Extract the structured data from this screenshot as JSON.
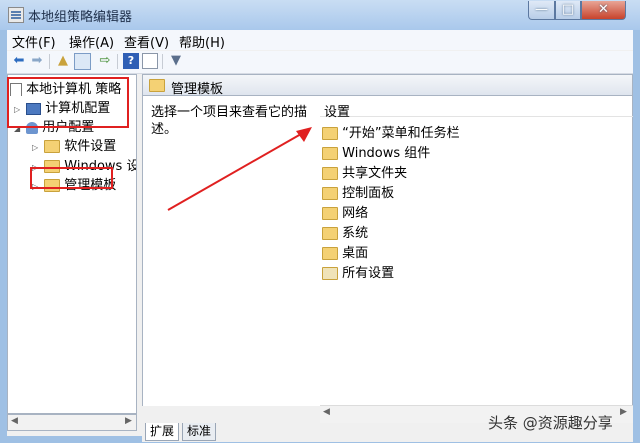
{
  "window": {
    "title": "本地组策略编辑器",
    "controls": {
      "minimize": "—",
      "maximize": "□",
      "close": "✕"
    }
  },
  "menubar": [
    "文件(F)",
    "操作(A)",
    "查看(V)",
    "帮助(H)"
  ],
  "toolbar": {
    "icons": [
      "back-arrow-icon",
      "forward-arrow-icon",
      "up-folder-icon",
      "show-hide-tree-icon",
      "export-icon",
      "help-icon",
      "properties-icon",
      "filter-icon"
    ]
  },
  "tree": {
    "root": "本地计算机 策略",
    "computer_config": "计算机配置",
    "user_config": "用户配置",
    "software_settings": "软件设置",
    "windows_settings": "Windows 设置",
    "admin_templates": "管理模板"
  },
  "pane": {
    "header": "管理模板",
    "description": "选择一个项目来查看它的描述。",
    "column_header": "设置",
    "items": [
      "“开始”菜单和任务栏",
      "Windows 组件",
      "共享文件夹",
      "控制面板",
      "网络",
      "系统",
      "桌面",
      "所有设置"
    ]
  },
  "tabs": [
    "扩展",
    "标准"
  ],
  "watermark": "头条 @资源趣分享",
  "colors": {
    "annotation": "#e02020",
    "title_bg": "#b8d1ee",
    "folder": "#f4d174"
  }
}
